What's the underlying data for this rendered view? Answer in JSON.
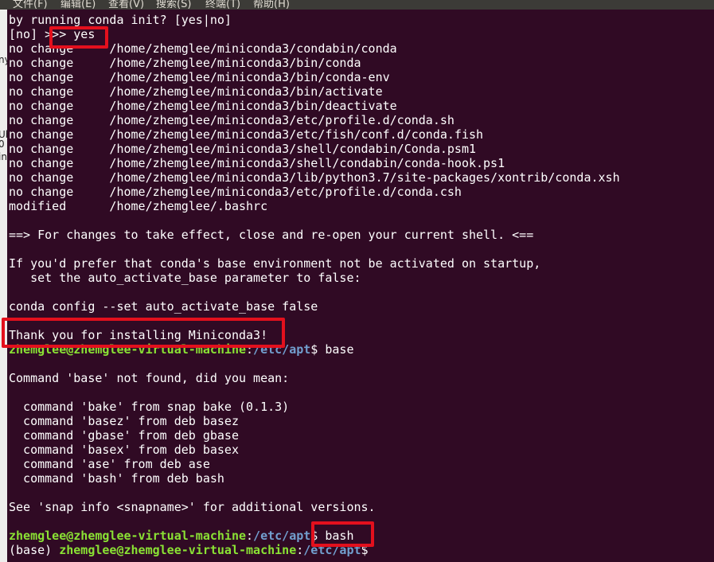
{
  "menubar": {
    "items": [
      "文件(F)",
      "编辑(E)",
      "查看(V)",
      "搜索(S)",
      "终端(T)",
      "帮助(H)"
    ]
  },
  "left_strip": {
    "fragments": [
      "ny",
      "Ub",
      "0",
      "in"
    ]
  },
  "terminal": {
    "colors": {
      "background": "#300a24",
      "text": "#ffffff",
      "user_host": "#8ae234",
      "path": "#729fcf",
      "highlight": "#e3101d"
    },
    "lines": [
      {
        "text": "by running conda init? [yes|no]"
      },
      {
        "text": "[no] >>> yes"
      },
      {
        "text": "no change     /home/zhemglee/miniconda3/condabin/conda"
      },
      {
        "text": "no change     /home/zhemglee/miniconda3/bin/conda"
      },
      {
        "text": "no change     /home/zhemglee/miniconda3/bin/conda-env"
      },
      {
        "text": "no change     /home/zhemglee/miniconda3/bin/activate"
      },
      {
        "text": "no change     /home/zhemglee/miniconda3/bin/deactivate"
      },
      {
        "text": "no change     /home/zhemglee/miniconda3/etc/profile.d/conda.sh"
      },
      {
        "text": "no change     /home/zhemglee/miniconda3/etc/fish/conf.d/conda.fish"
      },
      {
        "text": "no change     /home/zhemglee/miniconda3/shell/condabin/Conda.psm1"
      },
      {
        "text": "no change     /home/zhemglee/miniconda3/shell/condabin/conda-hook.ps1"
      },
      {
        "text": "no change     /home/zhemglee/miniconda3/lib/python3.7/site-packages/xontrib/conda.xsh"
      },
      {
        "text": "no change     /home/zhemglee/miniconda3/etc/profile.d/conda.csh"
      },
      {
        "text": "modified      /home/zhemglee/.bashrc"
      },
      {
        "text": ""
      },
      {
        "text": "==> For changes to take effect, close and re-open your current shell. <=="
      },
      {
        "text": ""
      },
      {
        "text": "If you'd prefer that conda's base environment not be activated on startup,"
      },
      {
        "text": "   set the auto_activate_base parameter to false:"
      },
      {
        "text": ""
      },
      {
        "text": "conda config --set auto_activate_base false"
      },
      {
        "text": ""
      },
      {
        "text": "Thank you for installing Miniconda3!"
      },
      {
        "prompt": {
          "env": "",
          "user": "zhemglee@zhemglee-virtual-machine",
          "sep": ":",
          "path": "/etc/apt",
          "dollar": "$ ",
          "cmd": "base"
        }
      },
      {
        "text": ""
      },
      {
        "text": "Command 'base' not found, did you mean:"
      },
      {
        "text": ""
      },
      {
        "text": "  command 'bake' from snap bake (0.1.3)"
      },
      {
        "text": "  command 'basez' from deb basez"
      },
      {
        "text": "  command 'gbase' from deb gbase"
      },
      {
        "text": "  command 'basex' from deb basex"
      },
      {
        "text": "  command 'ase' from deb ase"
      },
      {
        "text": "  command 'bash' from deb bash"
      },
      {
        "text": ""
      },
      {
        "text": "See 'snap info <snapname>' for additional versions."
      },
      {
        "text": ""
      },
      {
        "prompt": {
          "env": "",
          "user": "zhemglee@zhemglee-virtual-machine",
          "sep": ":",
          "path": "/etc/apt",
          "dollar": "$ ",
          "cmd": "bash"
        }
      },
      {
        "prompt": {
          "env": "(base) ",
          "user": "zhemglee@zhemglee-virtual-machine",
          "sep": ":",
          "path": "/etc/apt",
          "dollar": "$",
          "cmd": ""
        }
      }
    ]
  }
}
